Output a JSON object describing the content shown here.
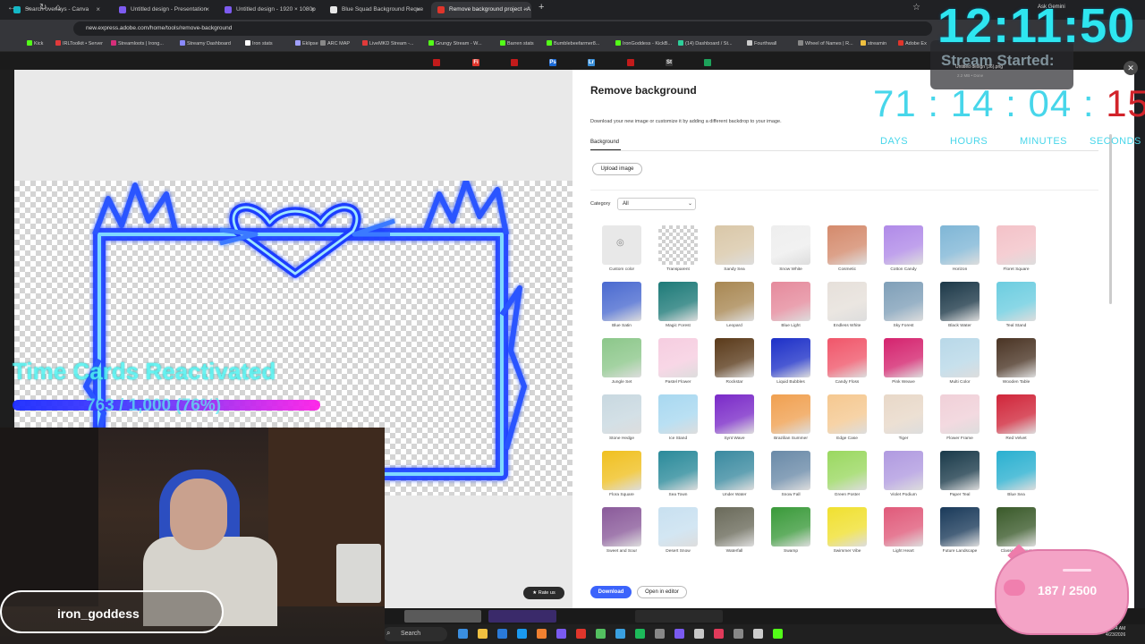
{
  "browser": {
    "tabs": [
      {
        "label": "Search overlays - Canva",
        "fav": "#14b8c6"
      },
      {
        "label": "Untitled design - Presentation",
        "fav": "#7d5bf0"
      },
      {
        "label": "Untitled design - 1920 × 1080p",
        "fav": "#7d5bf0"
      },
      {
        "label": "Blue Squad Background Reque",
        "fav": "#e8e8e8"
      },
      {
        "label": "Remove background project - A",
        "fav": "#e0352b"
      }
    ],
    "url": "new.express.adobe.com/home/tools/remove-background",
    "bookmarks": [
      "Kick",
      "IRLToolkit • Server",
      "Streamloots | Irong...",
      "Streamy Dashboard",
      "Iron stats",
      "Eklipse",
      "ARC MAP",
      "LiveMKD Stream -...",
      "Grungy Stream - W...",
      "Barren stats",
      "Bumblebeefarmer8...",
      "IronGoddess - KickB...",
      "(14) Dashboard / St...",
      "Fourthwall",
      "Wheel of Names | R...",
      "streamin",
      "Adobe Ex"
    ],
    "ask_gemini": "Ask Gemini"
  },
  "adobe_strip": {
    "icons": [
      {
        "label": "",
        "color": "#c21b1b"
      },
      {
        "label": "Fi",
        "color": "#e0352b"
      },
      {
        "label": "",
        "color": "#c21b1b"
      },
      {
        "label": "Ps",
        "color": "#1b6ad6"
      },
      {
        "label": "Lr",
        "color": "#3a8fd8"
      },
      {
        "label": "",
        "color": "#c21b1b"
      },
      {
        "label": "St",
        "color": "#3a3a3a"
      },
      {
        "label": "",
        "color": "#1da35b"
      }
    ]
  },
  "panel": {
    "title": "Remove background",
    "description": "Download your new image or customize it by adding a different backdrop to your image.",
    "tab": "Background",
    "upload_label": "Upload image",
    "category_label": "Category",
    "category_value": "All",
    "download_label": "Download",
    "editor_label": "Open in editor",
    "rate_label": "Rate us"
  },
  "backgrounds": [
    {
      "label": "Custom color",
      "color": "#e8e8e8"
    },
    {
      "label": "Transparent",
      "color": "checker"
    },
    {
      "label": "Sandy Sea",
      "color": "#d9c7a8"
    },
    {
      "label": "Snow White",
      "color": "#eeeeee"
    },
    {
      "label": "Cosmetic",
      "color": "#d48a6c"
    },
    {
      "label": "Cotton Candy",
      "color": "#b08ae8"
    },
    {
      "label": "Horizon",
      "color": "#7fb6d6"
    },
    {
      "label": "Floret Square",
      "color": "#f3c2c8"
    },
    {
      "label": "Blue Satin",
      "color": "#4a6ad0"
    },
    {
      "label": "Magic Forest",
      "color": "#1d7a78"
    },
    {
      "label": "Leopard",
      "color": "#a88752"
    },
    {
      "label": "Blue Light",
      "color": "#e58a9c"
    },
    {
      "label": "Endless White",
      "color": "#e6e0da"
    },
    {
      "label": "Sky Forest",
      "color": "#7f9fb8"
    },
    {
      "label": "Black Water",
      "color": "#1c3848"
    },
    {
      "label": "Teal Stand",
      "color": "#6ccde0"
    },
    {
      "label": "Jungle Set",
      "color": "#8cc78a"
    },
    {
      "label": "Pastel Flower",
      "color": "#f6cde0"
    },
    {
      "label": "Rockstar",
      "color": "#5a3a1a"
    },
    {
      "label": "Liquid Bubbles",
      "color": "#1d30c8"
    },
    {
      "label": "Candy Floss",
      "color": "#f0566a"
    },
    {
      "label": "Pink Weave",
      "color": "#d4236e"
    },
    {
      "label": "Multi Color",
      "color": "#b8d8e8"
    },
    {
      "label": "Wooden Table",
      "color": "#4a3424"
    },
    {
      "label": "Stone Hedge",
      "color": "#c8d8e0"
    },
    {
      "label": "Ice Stand",
      "color": "#a8d8f0"
    },
    {
      "label": "Synt Wave",
      "color": "#7a2ac8"
    },
    {
      "label": "Brazilian Summer",
      "color": "#f0a050"
    },
    {
      "label": "Edge Case",
      "color": "#f5c890"
    },
    {
      "label": "Tiger",
      "color": "#e8d8c8"
    },
    {
      "label": "Flower Frame",
      "color": "#f0d0d8"
    },
    {
      "label": "Red Velvet",
      "color": "#d0263a"
    },
    {
      "label": "Flora Square",
      "color": "#f0c020"
    },
    {
      "label": "Sea Town",
      "color": "#2a8a9a"
    },
    {
      "label": "Under Water",
      "color": "#3a8aa0"
    },
    {
      "label": "Snow Fall",
      "color": "#6a8aa8"
    },
    {
      "label": "Green Poster",
      "color": "#9ad860"
    },
    {
      "label": "Violet Podium",
      "color": "#b09ae0"
    },
    {
      "label": "Paper Teal",
      "color": "#1a3a4a"
    },
    {
      "label": "Blue Sea",
      "color": "#2ab0d0"
    },
    {
      "label": "Sweet and Sour",
      "color": "#8a5a9a"
    },
    {
      "label": "Desert Snow",
      "color": "#c8e0f0"
    },
    {
      "label": "Waterfall",
      "color": "#6a6a5a"
    },
    {
      "label": "Swamp",
      "color": "#3a9a3a"
    },
    {
      "label": "Swimmer Vibe",
      "color": "#f0e030"
    },
    {
      "label": "Light Heart",
      "color": "#e05a7a"
    },
    {
      "label": "Future Landscape",
      "color": "#1a3a5a"
    },
    {
      "label": "Classic Bouquet",
      "color": "#3a5a2a"
    }
  ],
  "overlays": {
    "clock": "12:11:50",
    "stream_started": "Stream Started:",
    "download_name": "Untitled design (36).png",
    "download_status": "2.2 MB • Done",
    "countdown": {
      "days": "71",
      "hours": "14",
      "minutes": "04",
      "seconds": "15"
    },
    "countdown_labels": [
      "DAYS",
      "HOURS",
      "MINUTES",
      "SECONDS"
    ],
    "time_cards_title": "Time Cards Reactivated",
    "time_cards_progress": "763 / 1,000 (76%)",
    "time_cards_fraction": 0.763,
    "username": "iron_goddess",
    "pig_count": "187 / 2500"
  },
  "taskbar": {
    "search": "Search",
    "tray_time": "12:04 AM",
    "tray_date": "4/23/2026"
  }
}
